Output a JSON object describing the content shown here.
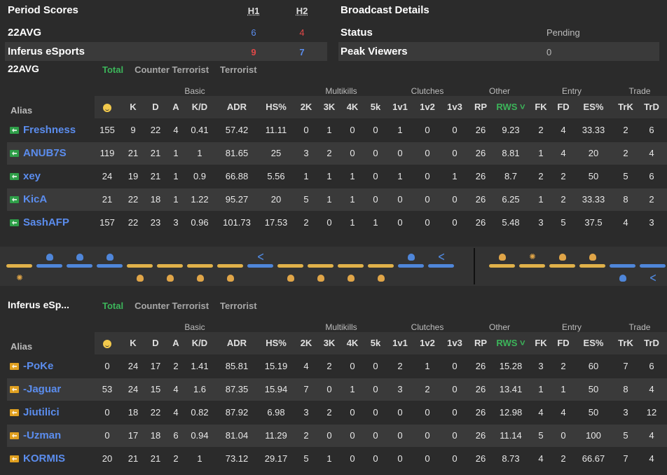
{
  "period_scores": {
    "title": "Period Scores",
    "halves": [
      "H1",
      "H2"
    ],
    "teams": [
      {
        "name": "22AVG",
        "h1": "6",
        "h2": "4",
        "h1_color": "#5b8dee",
        "h2_color": "#e04848"
      },
      {
        "name": "Inferus eSports",
        "h1": "9",
        "h2": "7",
        "h1_color": "#e04848",
        "h2_color": "#5b8dee"
      }
    ]
  },
  "broadcast": {
    "title": "Broadcast Details",
    "rows": [
      {
        "label": "Status",
        "value": "Pending"
      },
      {
        "label": "Peak Viewers",
        "value": "0"
      }
    ]
  },
  "tabs": {
    "total": "Total",
    "ct": "Counter Terrorist",
    "t": "Terrorist"
  },
  "groups": {
    "basic": "Basic",
    "multikills": "Multikills",
    "clutches": "Clutches",
    "other": "Other",
    "entry": "Entry",
    "trade": "Trade"
  },
  "columns": {
    "alias": "Alias",
    "k": "K",
    "d": "D",
    "a": "A",
    "kd": "K/D",
    "adr": "ADR",
    "hs": "HS%",
    "k2": "2K",
    "k3": "3K",
    "k4": "4K",
    "k5": "5k",
    "v1": "1v1",
    "v2": "1v2",
    "v3": "1v3",
    "rp": "RP",
    "rws": "RWS ˅",
    "fk": "FK",
    "fd": "FD",
    "es": "ES%",
    "trk": "TrK",
    "trd": "TrD"
  },
  "team1": {
    "name": "22AVG",
    "players": [
      {
        "alias": "Freshness",
        "smile": "155",
        "k": "9",
        "d": "22",
        "a": "4",
        "kd": "0.41",
        "adr": "57.42",
        "hs": "11.11",
        "k2": "0",
        "k3": "1",
        "k4": "0",
        "k5": "0",
        "v1": "1",
        "v2": "0",
        "v3": "0",
        "rp": "26",
        "rws": "9.23",
        "fk": "2",
        "fd": "4",
        "es": "33.33",
        "trk": "2",
        "trd": "6"
      },
      {
        "alias": "ANUB7S",
        "smile": "119",
        "k": "21",
        "d": "21",
        "a": "1",
        "kd": "1",
        "adr": "81.65",
        "hs": "25",
        "k2": "3",
        "k3": "2",
        "k4": "0",
        "k5": "0",
        "v1": "0",
        "v2": "0",
        "v3": "0",
        "rp": "26",
        "rws": "8.81",
        "fk": "1",
        "fd": "4",
        "es": "20",
        "trk": "2",
        "trd": "4"
      },
      {
        "alias": "xey",
        "smile": "24",
        "k": "19",
        "d": "21",
        "a": "1",
        "kd": "0.9",
        "adr": "66.88",
        "hs": "5.56",
        "k2": "1",
        "k3": "1",
        "k4": "1",
        "k5": "0",
        "v1": "1",
        "v2": "0",
        "v3": "1",
        "rp": "26",
        "rws": "8.7",
        "fk": "2",
        "fd": "2",
        "es": "50",
        "trk": "5",
        "trd": "6"
      },
      {
        "alias": "KicA",
        "smile": "21",
        "k": "22",
        "d": "18",
        "a": "1",
        "kd": "1.22",
        "adr": "95.27",
        "hs": "20",
        "k2": "5",
        "k3": "1",
        "k4": "1",
        "k5": "0",
        "v1": "0",
        "v2": "0",
        "v3": "0",
        "rp": "26",
        "rws": "6.25",
        "fk": "1",
        "fd": "2",
        "es": "33.33",
        "trk": "8",
        "trd": "2"
      },
      {
        "alias": "SashAFP",
        "smile": "157",
        "k": "22",
        "d": "23",
        "a": "3",
        "kd": "0.96",
        "adr": "101.73",
        "hs": "17.53",
        "k2": "2",
        "k3": "0",
        "k4": "1",
        "k5": "1",
        "v1": "0",
        "v2": "0",
        "v3": "0",
        "rp": "26",
        "rws": "5.48",
        "fk": "3",
        "fd": "5",
        "es": "37.5",
        "trk": "4",
        "trd": "3"
      }
    ]
  },
  "team2": {
    "name": "Inferus eSp...",
    "players": [
      {
        "alias": "-PoKe",
        "smile": "0",
        "k": "24",
        "d": "17",
        "a": "2",
        "kd": "1.41",
        "adr": "85.81",
        "hs": "15.19",
        "k2": "4",
        "k3": "2",
        "k4": "0",
        "k5": "0",
        "v1": "2",
        "v2": "1",
        "v3": "0",
        "rp": "26",
        "rws": "15.28",
        "fk": "3",
        "fd": "2",
        "es": "60",
        "trk": "7",
        "trd": "6"
      },
      {
        "alias": "-Jaguar",
        "smile": "53",
        "k": "24",
        "d": "15",
        "a": "4",
        "kd": "1.6",
        "adr": "87.35",
        "hs": "15.94",
        "k2": "7",
        "k3": "0",
        "k4": "1",
        "k5": "0",
        "v1": "3",
        "v2": "2",
        "v3": "0",
        "rp": "26",
        "rws": "13.41",
        "fk": "1",
        "fd": "1",
        "es": "50",
        "trk": "8",
        "trd": "4"
      },
      {
        "alias": "Jiutilici",
        "smile": "0",
        "k": "18",
        "d": "22",
        "a": "4",
        "kd": "0.82",
        "adr": "87.92",
        "hs": "6.98",
        "k2": "3",
        "k3": "2",
        "k4": "0",
        "k5": "0",
        "v1": "0",
        "v2": "0",
        "v3": "0",
        "rp": "26",
        "rws": "12.98",
        "fk": "4",
        "fd": "4",
        "es": "50",
        "trk": "3",
        "trd": "12"
      },
      {
        "alias": "-Uzman",
        "smile": "0",
        "k": "17",
        "d": "18",
        "a": "6",
        "kd": "0.94",
        "adr": "81.04",
        "hs": "11.29",
        "k2": "2",
        "k3": "0",
        "k4": "0",
        "k5": "0",
        "v1": "0",
        "v2": "0",
        "v3": "0",
        "rp": "26",
        "rws": "11.14",
        "fk": "5",
        "fd": "0",
        "es": "100",
        "trk": "5",
        "trd": "4"
      },
      {
        "alias": "KORMIS",
        "smile": "20",
        "k": "21",
        "d": "21",
        "a": "2",
        "kd": "1",
        "adr": "73.12",
        "hs": "29.17",
        "k2": "5",
        "k3": "1",
        "k4": "0",
        "k5": "0",
        "v1": "0",
        "v2": "0",
        "v3": "0",
        "rp": "26",
        "rws": "8.73",
        "fk": "4",
        "fd": "2",
        "es": "66.67",
        "trk": "7",
        "trd": "4"
      }
    ]
  },
  "timeline": {
    "rounds": [
      {
        "winner": "t",
        "icon": "bomb",
        "icon_side": "t"
      },
      {
        "winner": "ct",
        "icon": "skull",
        "icon_side": "ct"
      },
      {
        "winner": "ct",
        "icon": "skull",
        "icon_side": "ct"
      },
      {
        "winner": "ct",
        "icon": "skull",
        "icon_side": "ct"
      },
      {
        "winner": "t",
        "icon": "skull",
        "icon_side": "t"
      },
      {
        "winner": "t",
        "icon": "skull",
        "icon_side": "t"
      },
      {
        "winner": "t",
        "icon": "skull",
        "icon_side": "t"
      },
      {
        "winner": "t",
        "icon": "skull",
        "icon_side": "t"
      },
      {
        "winner": "ct",
        "icon": "defuse",
        "icon_side": "ct"
      },
      {
        "winner": "t",
        "icon": "skull",
        "icon_side": "t"
      },
      {
        "winner": "t",
        "icon": "skull",
        "icon_side": "t"
      },
      {
        "winner": "t",
        "icon": "skull",
        "icon_side": "t"
      },
      {
        "winner": "t",
        "icon": "skull",
        "icon_side": "t"
      },
      {
        "winner": "ct",
        "icon": "skull",
        "icon_side": "ct"
      },
      {
        "winner": "ct",
        "icon": "defuse",
        "icon_side": "ct"
      },
      {
        "winner": "t",
        "icon": "skull",
        "icon_side": "t",
        "half_start": true
      },
      {
        "winner": "t",
        "icon": "bomb",
        "icon_side": "t"
      },
      {
        "winner": "t",
        "icon": "skull",
        "icon_side": "t"
      },
      {
        "winner": "t",
        "icon": "skull",
        "icon_side": "t"
      },
      {
        "winner": "ct",
        "icon": "skull",
        "icon_side": "ct"
      },
      {
        "winner": "ct",
        "icon": "defuse",
        "icon_side": "ct"
      }
    ],
    "colors": {
      "t": "#e0b14a",
      "ct": "#4f86d9"
    }
  }
}
